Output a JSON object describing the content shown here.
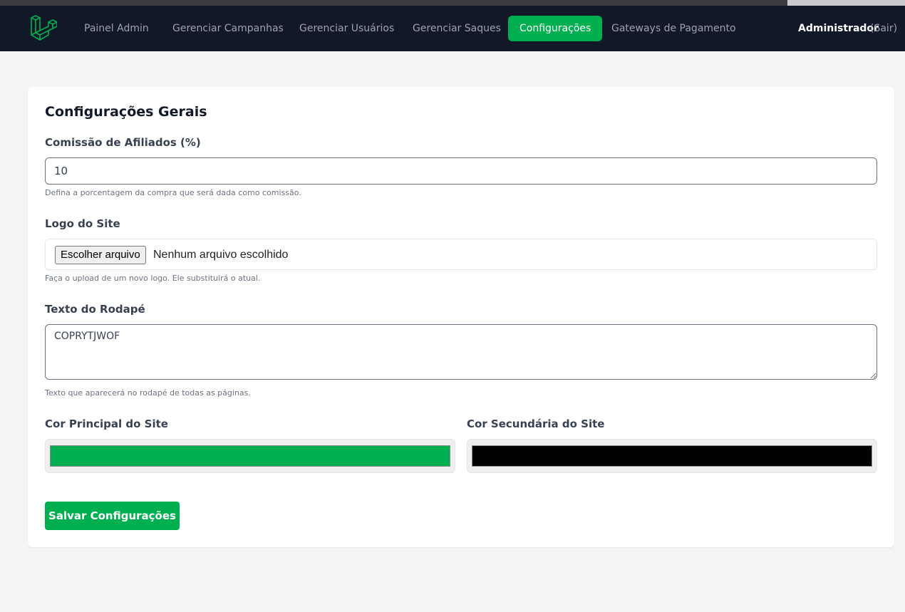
{
  "nav": {
    "items": [
      {
        "label": "Painel Admin",
        "active": false
      },
      {
        "label": "Gerenciar Campanhas",
        "active": false
      },
      {
        "label": "Gerenciar Usuários",
        "active": false
      },
      {
        "label": "Gerenciar Saques",
        "active": false
      },
      {
        "label": "Configurações",
        "active": true
      },
      {
        "label": "Gateways de Pagamento",
        "active": false
      }
    ],
    "user": "Administrador",
    "logout": "(Sair)"
  },
  "settings": {
    "title": "Configurações Gerais",
    "commission": {
      "label": "Comissão de Afiliados (%)",
      "value": "10",
      "help": "Defina a porcentagem da compra que será dada como comissão."
    },
    "logo": {
      "label": "Logo do Site",
      "button": "Escolher arquivo",
      "status": "Nenhum arquivo escolhido",
      "help": "Faça o upload de um novo logo. Ele substituirá o atual."
    },
    "footer": {
      "label": "Texto do Rodapé",
      "value": "COPRYTJWOF",
      "help": "Texto que aparecerá no rodapé de todas as páginas."
    },
    "primary_color": {
      "label": "Cor Principal do Site",
      "value": "#00b050"
    },
    "secondary_color": {
      "label": "Cor Secundária do Site",
      "value": "#000000"
    },
    "save_label": "Salvar Configurações"
  },
  "colors": {
    "brand_green": "#00b050",
    "navbar_bg": "#111827"
  }
}
